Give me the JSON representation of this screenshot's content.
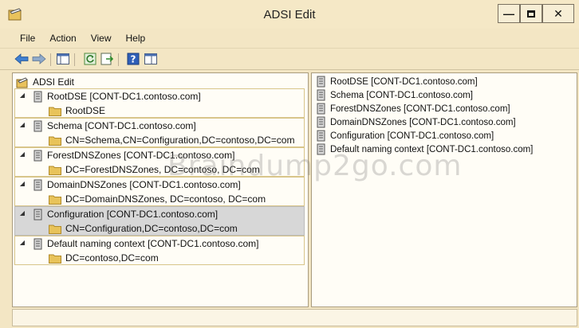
{
  "window": {
    "title": "ADSI Edit"
  },
  "menu": [
    "File",
    "Action",
    "View",
    "Help"
  ],
  "toolbar": {
    "icons": [
      "back-arrow-icon",
      "forward-arrow-icon",
      "show-hide-console-tree-icon",
      "refresh-icon",
      "export-list-icon",
      "help-icon",
      "properties-icon"
    ]
  },
  "tree": {
    "root_label": "ADSI Edit",
    "nodes": [
      {
        "label": "RootDSE [CONT-DC1.contoso.com]",
        "child": "RootDSE"
      },
      {
        "label": "Schema [CONT-DC1.contoso.com]",
        "child": "CN=Schema,CN=Configuration,DC=contoso,DC=com"
      },
      {
        "label": "ForestDNSZones [CONT-DC1.contoso.com]",
        "child": "DC=ForestDNSZones, DC=contoso, DC=com"
      },
      {
        "label": "DomainDNSZones [CONT-DC1.contoso.com]",
        "child": "DC=DomainDNSZones, DC=contoso, DC=com"
      },
      {
        "label": "Configuration [CONT-DC1.contoso.com]",
        "child": "CN=Configuration,DC=contoso,DC=com"
      },
      {
        "label": "Default naming context [CONT-DC1.contoso.com]",
        "child": "DC=contoso,DC=com"
      }
    ]
  },
  "details": {
    "items": [
      "RootDSE [CONT-DC1.contoso.com]",
      "Schema [CONT-DC1.contoso.com]",
      "ForestDNSZones [CONT-DC1.contoso.com]",
      "DomainDNSZones [CONT-DC1.contoso.com]",
      "Configuration [CONT-DC1.contoso.com]",
      "Default naming context [CONT-DC1.contoso.com]"
    ]
  },
  "watermark": "Braindump2go.com",
  "colors": {
    "window_frame": "#f3e6c4",
    "selection": "#d7d7d7",
    "folder": "#e8c35a",
    "group_border": "#d8c58a"
  }
}
